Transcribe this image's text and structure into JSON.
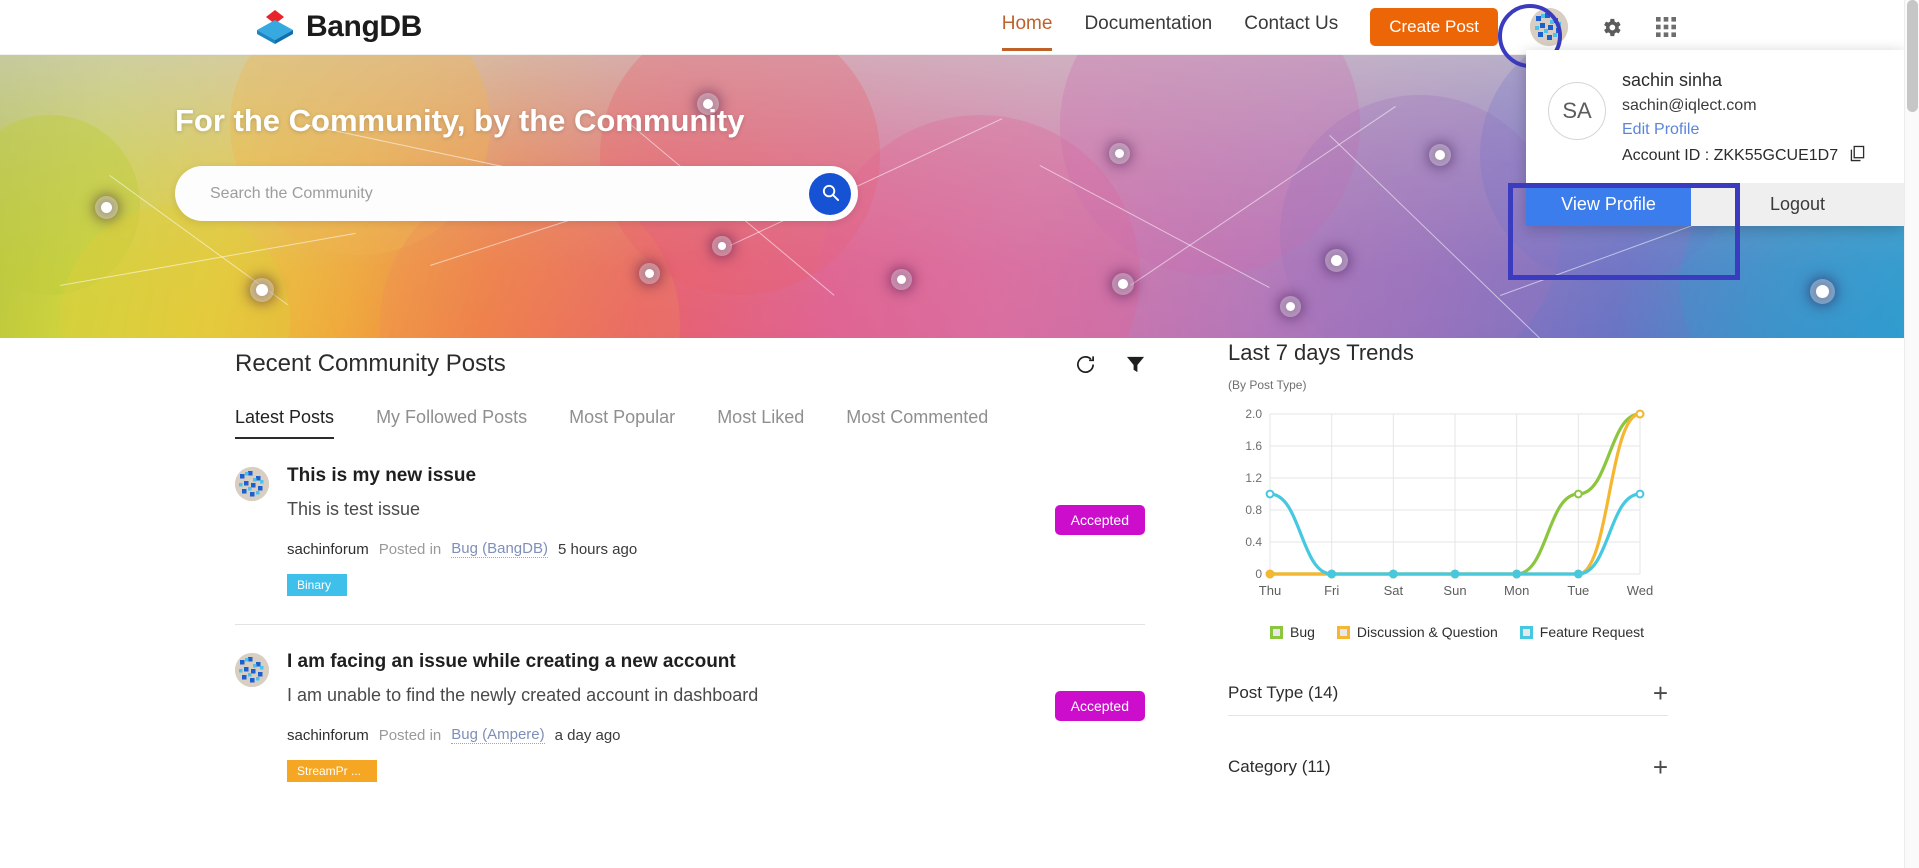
{
  "brand": {
    "name": "BangDB",
    "logo_icon": "bangdb-cube-logo"
  },
  "header": {
    "nav": [
      {
        "label": "Home",
        "active": true
      },
      {
        "label": "Documentation",
        "active": false
      },
      {
        "label": "Contact Us",
        "active": false
      }
    ],
    "create_post_label": "Create Post",
    "icons": [
      "user-avatar-icon",
      "gear-icon",
      "apps-grid-icon"
    ],
    "accent_color": "#ec6608",
    "active_nav_color": "#c0612a"
  },
  "hero": {
    "title": "For the Community, by the Community",
    "search_placeholder": "Search the Community",
    "search_value": "",
    "search_icon": "search-icon",
    "search_button_color": "#1652d4"
  },
  "user_menu": {
    "initials": "SA",
    "name": "sachin sinha",
    "email": "sachin@iqlect.com",
    "edit_profile_label": "Edit Profile",
    "account_id_label": "Account ID : ZKK55GCUE1D7",
    "copy_icon": "copy-icon",
    "view_profile_label": "View Profile",
    "logout_label": "Logout",
    "view_profile_color": "#3b7ded",
    "highlight_color": "#3b3bbf"
  },
  "posts_section": {
    "title": "Recent Community Posts",
    "refresh_icon": "refresh-icon",
    "filter_icon": "funnel-filter-icon",
    "tabs": [
      {
        "label": "Latest Posts",
        "active": true
      },
      {
        "label": "My Followed Posts",
        "active": false
      },
      {
        "label": "Most Popular",
        "active": false
      },
      {
        "label": "Most Liked",
        "active": false
      },
      {
        "label": "Most Commented",
        "active": false
      }
    ],
    "posts": [
      {
        "avatar_icon": "identicon-avatar",
        "title": "This is my new issue",
        "description": "This is test issue",
        "author": "sachinforum",
        "posted_in_prefix": "Posted in",
        "category": "Bug (BangDB)",
        "time": "5 hours ago",
        "tag": "Binary",
        "tag_color": "#3fc0ea",
        "status": "Accepted",
        "status_color": "#cc0ecc"
      },
      {
        "avatar_icon": "identicon-avatar",
        "title": "I am facing an issue while creating a new account",
        "description": "I am unable to find the newly created account in dashboard",
        "author": "sachinforum",
        "posted_in_prefix": "Posted in",
        "category": "Bug (Ampere)",
        "time": "a day ago",
        "tag": "StreamPr ...",
        "tag_color": "#f5a623",
        "status": "Accepted",
        "status_color": "#cc0ecc"
      }
    ]
  },
  "right_panel": {
    "title": "Last 7 days Trends",
    "subtitle": "(By Post Type)",
    "filters": [
      {
        "label": "Post Type (14)",
        "expand_icon": "plus-icon"
      },
      {
        "label": "Category (11)",
        "expand_icon": "plus-icon"
      }
    ]
  },
  "chart_data": {
    "type": "line",
    "title": "Last 7 days Trends",
    "subtitle": "(By Post Type)",
    "xlabel": "",
    "ylabel": "",
    "x": [
      "Thu",
      "Fri",
      "Sat",
      "Sun",
      "Mon",
      "Tue",
      "Wed"
    ],
    "ylim": [
      0,
      2.0
    ],
    "yticks": [
      0,
      0.4,
      0.8,
      1.2,
      1.6,
      2.0
    ],
    "ytick_labels": [
      "0",
      "0.4",
      "0.8",
      "1.2",
      "1.6",
      "2.0"
    ],
    "grid": true,
    "legend_position": "bottom",
    "series": [
      {
        "name": "Bug",
        "color": "#8cc63e",
        "values": [
          0,
          0,
          0,
          0,
          0,
          1,
          2
        ]
      },
      {
        "name": "Discussion & Question",
        "color": "#f5b731",
        "values": [
          0,
          0,
          0,
          0,
          0,
          0,
          2
        ]
      },
      {
        "name": "Feature Request",
        "color": "#45c8e0",
        "values": [
          1,
          0,
          0,
          0,
          0,
          0,
          1
        ]
      }
    ]
  }
}
